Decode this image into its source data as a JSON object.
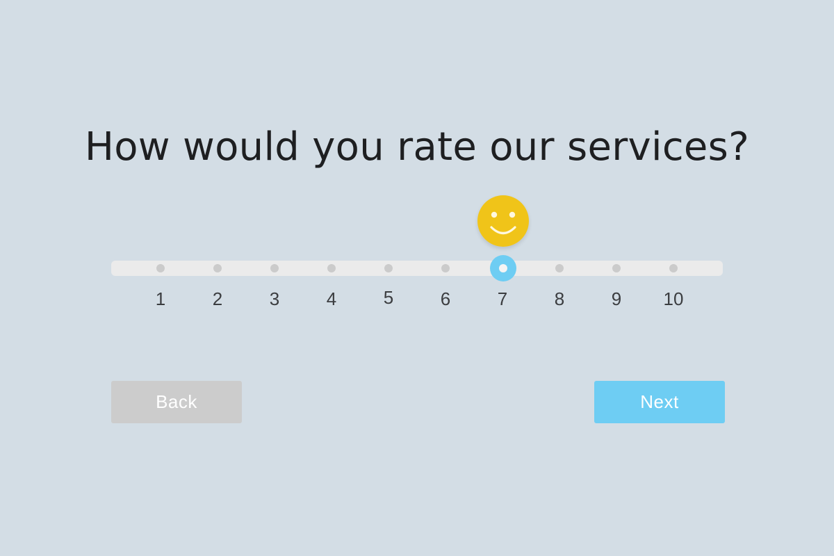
{
  "question": "How would you rate our services?",
  "rating": {
    "min": 1,
    "max": 10,
    "selected": 7,
    "labels": [
      "1",
      "2",
      "3",
      "4",
      "5",
      "6",
      "7",
      "8",
      "9",
      "10"
    ],
    "mood_icon": "smiley-face-icon"
  },
  "buttons": {
    "back_label": "Back",
    "next_label": "Next"
  },
  "colors": {
    "background": "#d3dde5",
    "track": "#ebebeb",
    "tick_dot": "#cbcbcb",
    "thumb": "#6ecdf3",
    "smiley": "#f0c419",
    "back_button": "#cccccc",
    "next_button": "#6ecdf3"
  }
}
